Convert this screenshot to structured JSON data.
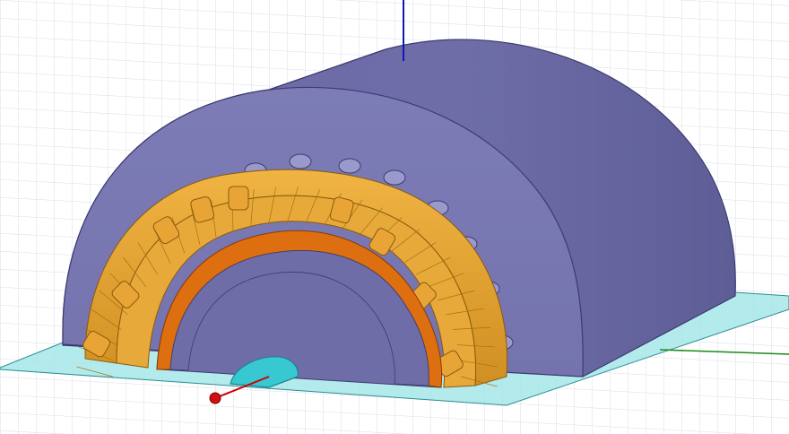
{
  "viewport": {
    "description_visible_text": "",
    "colors": {
      "background": "#ffffff",
      "grid": "#d9dde6",
      "stator_body": "#6f6ea8",
      "stator_body_dark": "#5f5e98",
      "stator_face": "#7a79b3",
      "coil_copper": "#e2a030",
      "coil_copper_dark": "#b87a18",
      "coil_edge": "#8a5a10",
      "rotor_ring": "#dd6f10",
      "ground_plane": "#9fe3e6",
      "ground_plane_edge": "#2a8e96",
      "feed_port": "#37c8d2",
      "axis_x": "#cc0000",
      "axis_y": "#1a8a1a",
      "axis_z": "#0a1ab8",
      "origin_marker": "#d01010"
    },
    "icons": [
      "origin-marker-icon"
    ]
  }
}
